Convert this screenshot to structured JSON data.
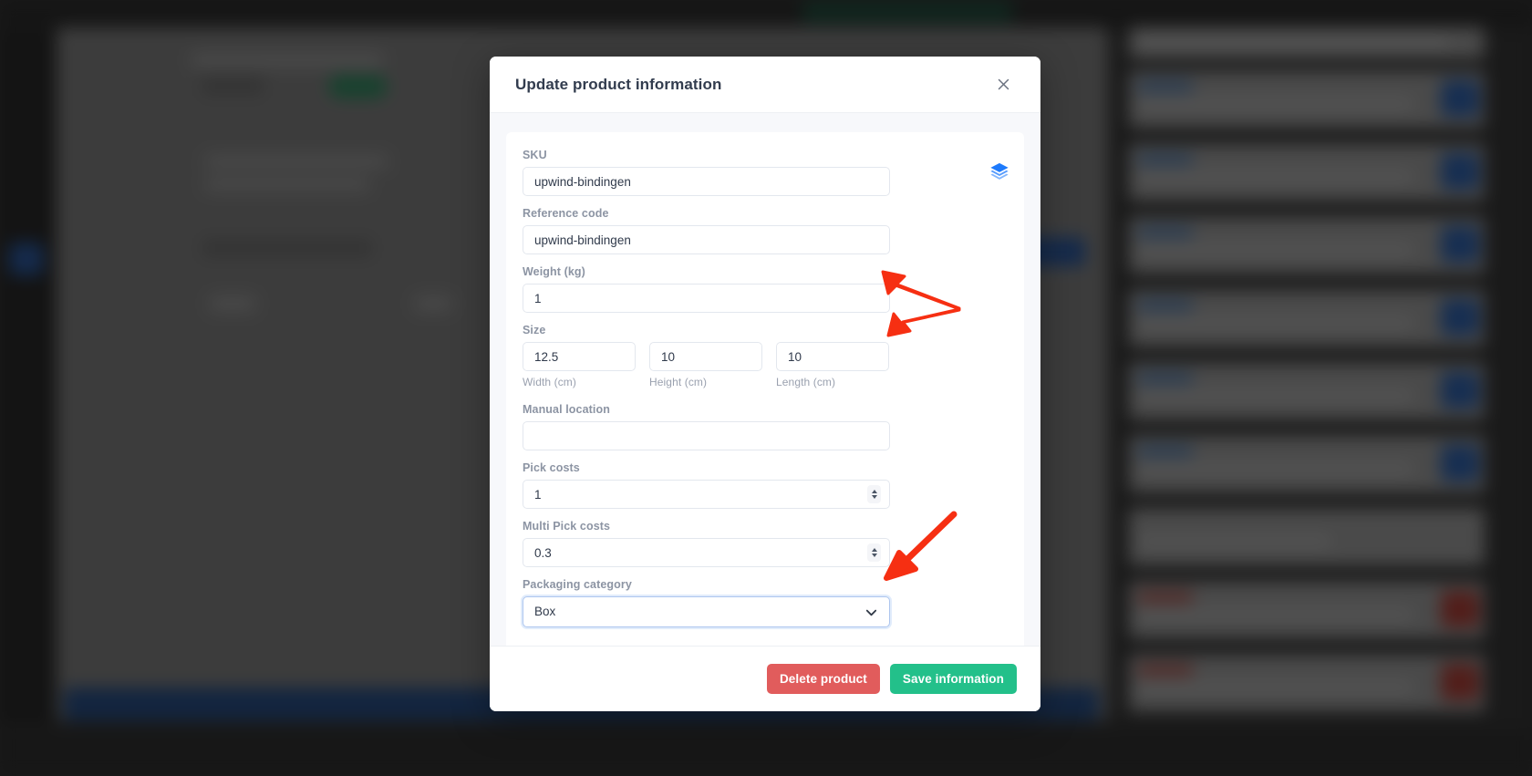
{
  "modal": {
    "title": "Update product information",
    "close_icon": "close-icon",
    "stack_icon": "layers-icon",
    "fields": {
      "sku": {
        "label": "SKU",
        "value": "upwind-bindingen",
        "placeholder": ""
      },
      "reference_code": {
        "label": "Reference code",
        "value": "upwind-bindingen",
        "placeholder": ""
      },
      "weight": {
        "label": "Weight (kg)",
        "value": "1",
        "placeholder": ""
      },
      "size": {
        "label": "Size",
        "width": {
          "value": "12.5",
          "sub_label": "Width (cm)"
        },
        "height": {
          "value": "10",
          "sub_label": "Height (cm)"
        },
        "length": {
          "value": "10",
          "sub_label": "Length (cm)"
        }
      },
      "manual_location": {
        "label": "Manual location",
        "value": "",
        "placeholder": ""
      },
      "pick_costs": {
        "label": "Pick costs",
        "value": "1",
        "placeholder": ""
      },
      "multi_pick_costs": {
        "label": "Multi Pick costs",
        "value": "0.3",
        "placeholder": ""
      },
      "packaging_category": {
        "label": "Packaging category",
        "value": "Box",
        "chevron_icon": "chevron-down-icon"
      }
    },
    "footer": {
      "delete_label": "Delete product",
      "save_label": "Save information"
    }
  },
  "colors": {
    "danger": "#e15c5c",
    "success": "#23c08a",
    "accent_blue": "#1d7afc",
    "focus_border": "#aec6ef",
    "annotation_red": "#f62f12"
  },
  "annotations": [
    {
      "name": "arrow-weight-size-double",
      "shape": "double-arrow"
    },
    {
      "name": "arrow-packaging-category",
      "shape": "single-arrow"
    }
  ]
}
